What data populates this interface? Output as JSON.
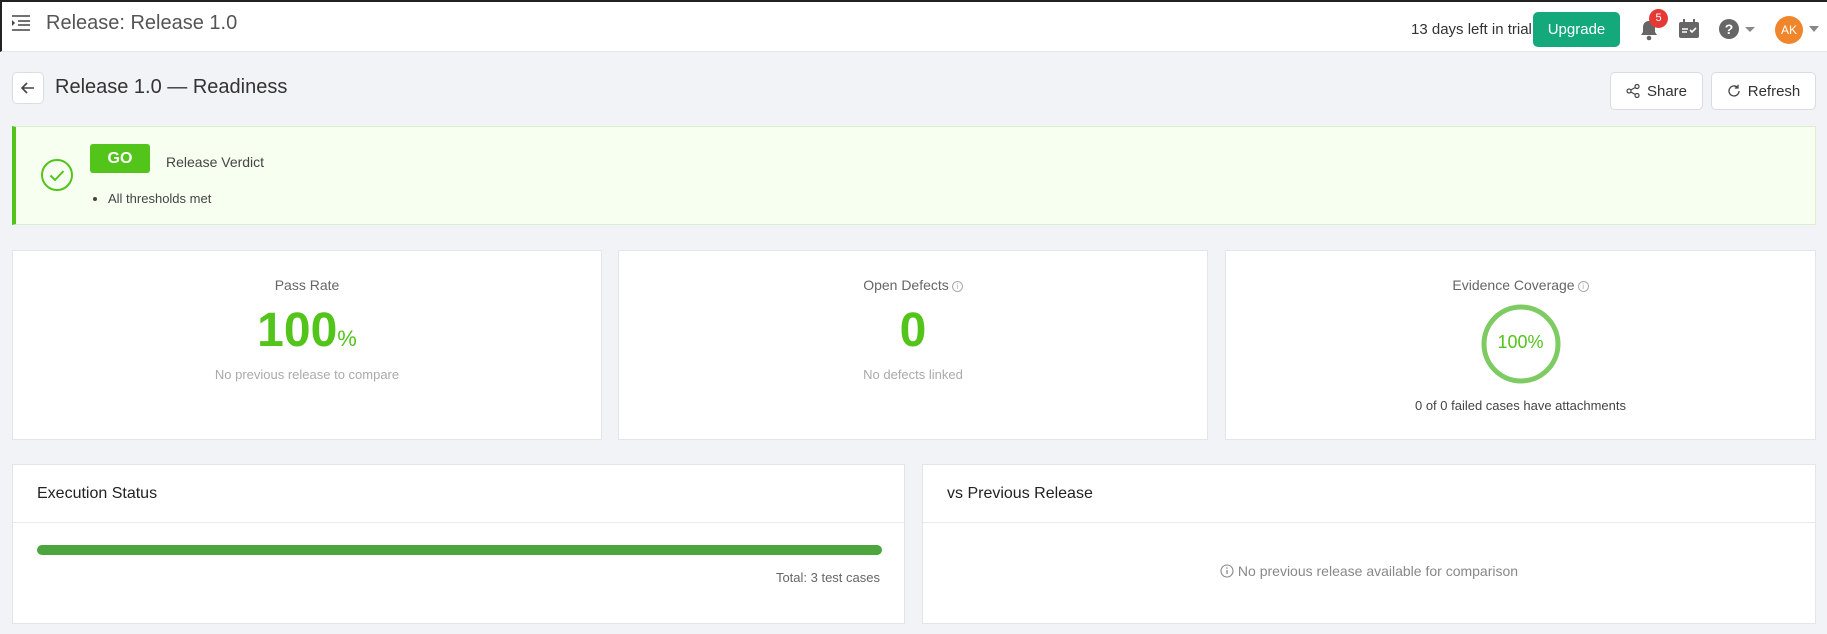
{
  "header": {
    "title": "Release: Release 1.0",
    "trial_text": "13 days left in trial",
    "upgrade_label": "Upgrade",
    "notification_count": "5",
    "avatar_initials": "AK",
    "icons": [
      "menu-icon",
      "bell-icon",
      "calendar-check-icon",
      "help-icon",
      "chevron-down-icon"
    ]
  },
  "page": {
    "title": "Release 1.0 — Readiness",
    "share_label": "Share",
    "refresh_label": "Refresh"
  },
  "verdict": {
    "badge": "GO",
    "label": "Release Verdict",
    "reasons": [
      "All thresholds met"
    ],
    "color": "#52c41a"
  },
  "metrics": {
    "pass_rate": {
      "title": "Pass Rate",
      "value": "100",
      "unit": "%",
      "subtitle": "No previous release to compare"
    },
    "open_defects": {
      "title": "Open Defects",
      "value": "0",
      "subtitle": "No defects linked"
    },
    "evidence_coverage": {
      "title": "Evidence Coverage",
      "value": "100%",
      "fraction": 1.0,
      "subtitle": "0 of 0 failed cases have attachments"
    }
  },
  "execution": {
    "title": "Execution Status",
    "progress_fraction": 1.0,
    "total_label": "Total: 3 test cases"
  },
  "comparison": {
    "title": "vs Previous Release",
    "empty_message": "No previous release available for comparison"
  },
  "colors": {
    "accent_green": "#52c41a",
    "upgrade_green": "#13a97b",
    "badge_red": "#e53935",
    "avatar_orange": "#f0862b",
    "progress_green": "#4ca53d"
  }
}
